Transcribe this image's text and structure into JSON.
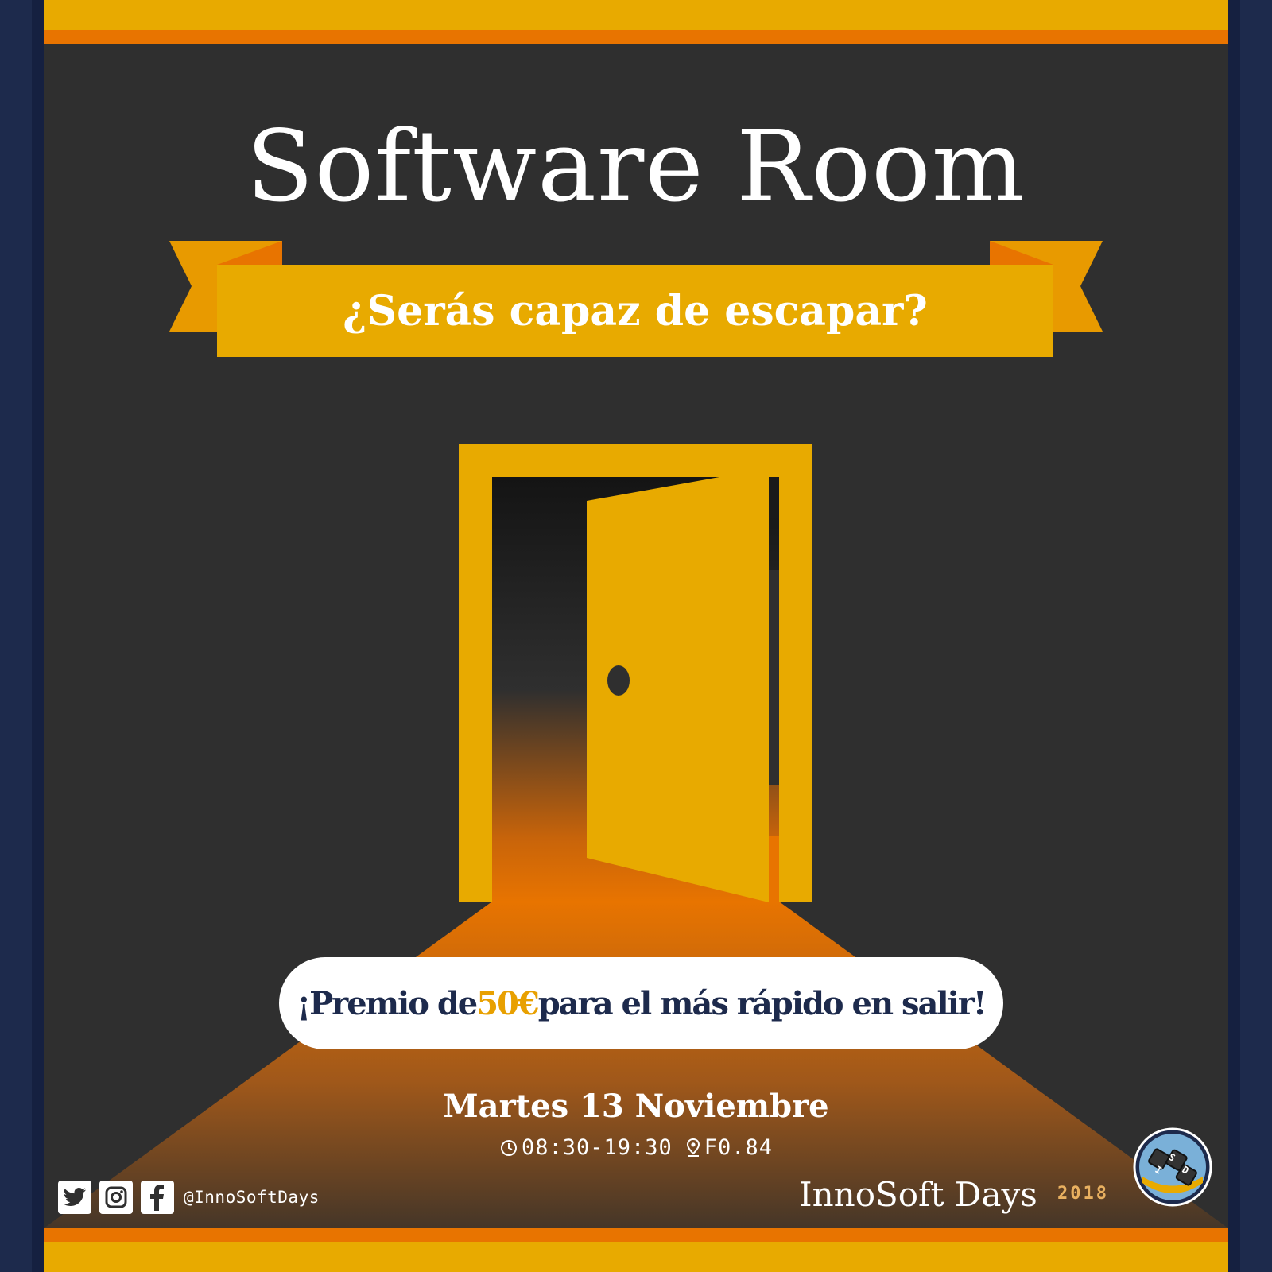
{
  "poster": {
    "title": "Software Room",
    "subtitle": "¿Serás capaz de escapar?",
    "prize": {
      "before": "¡Premio de ",
      "amount": "50€",
      "after": " para el más rápido en salir!"
    },
    "date": "Martes 13 Noviembre",
    "time": "08:30-19:30",
    "location": "F0.84",
    "social_handle": "@InnoSoftDays",
    "brand": "InnoSoft Days",
    "year": "2018",
    "logo_letters": [
      "I",
      "S",
      "D"
    ],
    "icons": [
      "clock-icon",
      "location-pin-icon",
      "twitter-icon",
      "instagram-icon",
      "facebook-icon",
      "door-icon",
      "innosoft-logo"
    ]
  },
  "colors": {
    "background": "#2f2f2f",
    "border_navy": "#1d2a4c",
    "accent_yellow": "#e8aa00",
    "accent_orange": "#e87400",
    "text_white": "#ffffff",
    "text_navy": "#1d2a4c"
  }
}
